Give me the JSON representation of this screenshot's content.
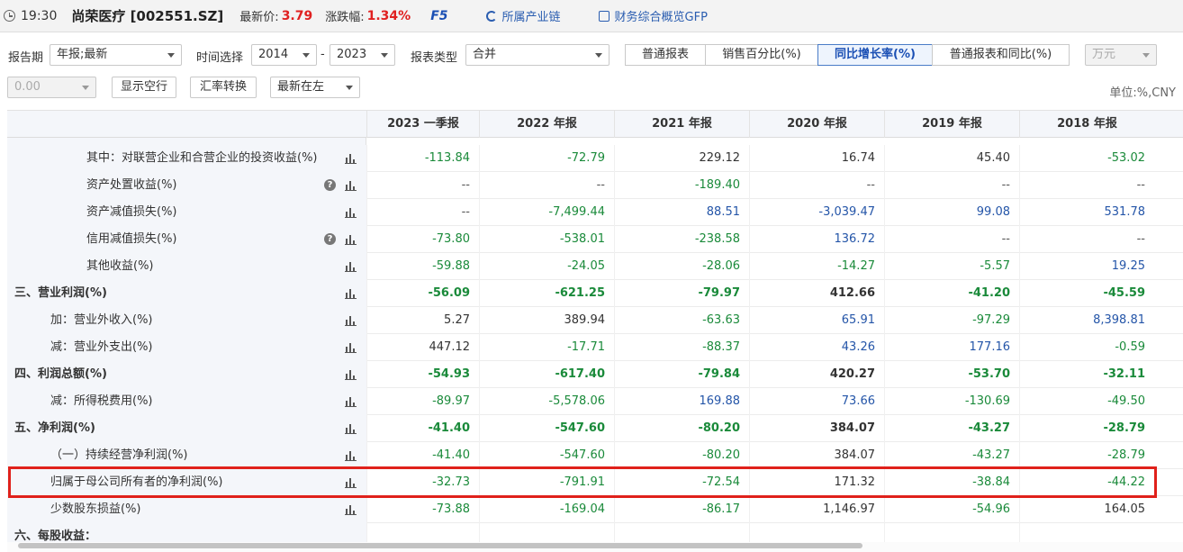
{
  "header": {
    "time": "19:30",
    "stock": "尚荣医疗 [002551.SZ]",
    "latest_price_label": "最新价:",
    "latest_price": "3.79",
    "change_label": "涨跌幅:",
    "change": "1.34%",
    "f5": "F5",
    "industry_chain": "所属产业链",
    "finance_overview": "财务综合概览GFP"
  },
  "toolbar": {
    "report_period_label": "报告期",
    "report_period_value": "年报;最新",
    "time_label": "时间选择",
    "year_from": "2014",
    "dash": "-",
    "year_to": "2023",
    "report_type_label": "报表类型",
    "report_type_value": "合并",
    "segments": [
      "普通报表",
      "销售百分比(%)",
      "同比增长率(%)",
      "普通报表和同比(%)"
    ],
    "active_segment": 2,
    "currency_unit": "万元",
    "decimal_value": "0.00",
    "show_empty_rows": "显示空行",
    "fx_convert": "汇率转换",
    "order_value": "最新在左",
    "unit_text": "单位:%,CNY"
  },
  "table": {
    "columns": [
      "2023 一季报",
      "2022 年报",
      "2021 年报",
      "2020 年报",
      "2019 年报",
      "2018 年报"
    ],
    "rows": [
      {
        "name": "其中：对联营企业和合营企业的投资收益(%)",
        "indent": 2,
        "bold": false,
        "help": false,
        "values": [
          "-113.84",
          "-72.79",
          "229.12",
          "16.74",
          "45.40",
          "-53.02"
        ],
        "colors": [
          "green",
          "green",
          "black",
          "black",
          "black",
          "green"
        ]
      },
      {
        "name": "资产处置收益(%)",
        "indent": 2,
        "bold": false,
        "help": true,
        "values": [
          "--",
          "--",
          "-189.40",
          "--",
          "--",
          "--"
        ],
        "colors": [
          "grey",
          "grey",
          "green",
          "grey",
          "grey",
          "grey"
        ]
      },
      {
        "name": "资产减值损失(%)",
        "indent": 2,
        "bold": false,
        "help": false,
        "values": [
          "--",
          "-7,499.44",
          "88.51",
          "-3,039.47",
          "99.08",
          "531.78"
        ],
        "colors": [
          "grey",
          "green",
          "blue",
          "blue",
          "blue",
          "blue"
        ]
      },
      {
        "name": "信用减值损失(%)",
        "indent": 2,
        "bold": false,
        "help": true,
        "values": [
          "-73.80",
          "-538.01",
          "-238.58",
          "136.72",
          "--",
          "--"
        ],
        "colors": [
          "green",
          "green",
          "green",
          "blue",
          "grey",
          "grey"
        ]
      },
      {
        "name": "其他收益(%)",
        "indent": 2,
        "bold": false,
        "help": false,
        "values": [
          "-59.88",
          "-24.05",
          "-28.06",
          "-14.27",
          "-5.57",
          "19.25"
        ],
        "colors": [
          "green",
          "green",
          "green",
          "green",
          "green",
          "blue"
        ]
      },
      {
        "name": "三、营业利润(%)",
        "indent": 0,
        "bold": true,
        "help": false,
        "values": [
          "-56.09",
          "-621.25",
          "-79.97",
          "412.66",
          "-41.20",
          "-45.59"
        ],
        "colors": [
          "green",
          "green",
          "green",
          "black",
          "green",
          "green"
        ]
      },
      {
        "name": "加：营业外收入(%)",
        "indent": 1,
        "bold": false,
        "help": false,
        "values": [
          "5.27",
          "389.94",
          "-63.63",
          "65.91",
          "-97.29",
          "8,398.81"
        ],
        "colors": [
          "black",
          "black",
          "green",
          "blue",
          "green",
          "blue"
        ]
      },
      {
        "name": "减：营业外支出(%)",
        "indent": 1,
        "bold": false,
        "help": false,
        "values": [
          "447.12",
          "-17.71",
          "-88.37",
          "43.26",
          "177.16",
          "-0.59"
        ],
        "colors": [
          "black",
          "green",
          "green",
          "blue",
          "blue",
          "green"
        ]
      },
      {
        "name": "四、利润总额(%)",
        "indent": 0,
        "bold": true,
        "help": false,
        "values": [
          "-54.93",
          "-617.40",
          "-79.84",
          "420.27",
          "-53.70",
          "-32.11"
        ],
        "colors": [
          "green",
          "green",
          "green",
          "black",
          "green",
          "green"
        ]
      },
      {
        "name": "减：所得税费用(%)",
        "indent": 1,
        "bold": false,
        "help": false,
        "values": [
          "-89.97",
          "-5,578.06",
          "169.88",
          "73.66",
          "-130.69",
          "-49.50"
        ],
        "colors": [
          "green",
          "green",
          "blue",
          "blue",
          "green",
          "green"
        ]
      },
      {
        "name": "五、净利润(%)",
        "indent": 0,
        "bold": true,
        "help": false,
        "values": [
          "-41.40",
          "-547.60",
          "-80.20",
          "384.07",
          "-43.27",
          "-28.79"
        ],
        "colors": [
          "green",
          "green",
          "green",
          "black",
          "green",
          "green"
        ]
      },
      {
        "name": "（一）持续经营净利润(%)",
        "indent": 1,
        "bold": false,
        "help": false,
        "values": [
          "-41.40",
          "-547.60",
          "-80.20",
          "384.07",
          "-43.27",
          "-28.79"
        ],
        "colors": [
          "green",
          "green",
          "green",
          "black",
          "green",
          "green"
        ]
      },
      {
        "name": "归属于母公司所有者的净利润(%)",
        "indent": 1,
        "bold": false,
        "help": false,
        "values": [
          "-32.73",
          "-791.91",
          "-72.54",
          "171.32",
          "-38.84",
          "-44.22"
        ],
        "colors": [
          "green",
          "green",
          "green",
          "black",
          "green",
          "green"
        ]
      },
      {
        "name": "少数股东损益(%)",
        "indent": 1,
        "bold": false,
        "help": false,
        "values": [
          "-73.88",
          "-169.04",
          "-86.17",
          "1,146.97",
          "-54.96",
          "164.05"
        ],
        "colors": [
          "green",
          "green",
          "green",
          "black",
          "green",
          "black"
        ]
      },
      {
        "name": "六、每股收益：",
        "indent": 0,
        "bold": true,
        "help": false,
        "values": [
          "",
          "",
          "",
          "",
          "",
          ""
        ],
        "colors": [
          "black",
          "black",
          "black",
          "black",
          "black",
          "black"
        ]
      }
    ],
    "highlighted_row": 12
  }
}
